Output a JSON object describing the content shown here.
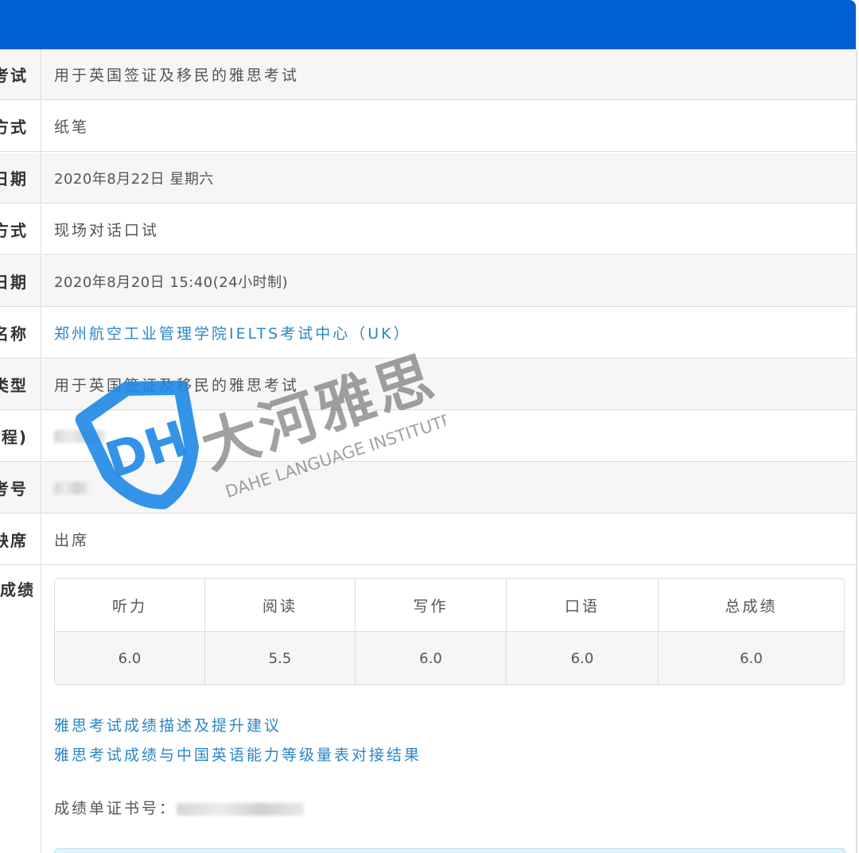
{
  "rows": [
    {
      "label": "考试",
      "value": "用于英国签证及移民的雅思考试"
    },
    {
      "label": "方式",
      "value": "纸笔"
    },
    {
      "label": "日期",
      "value": "2020年8月22日 星期六"
    },
    {
      "label": "方式",
      "value": "现场对话口试"
    },
    {
      "label": "日期",
      "value": "2020年8月20日 15:40(24小时制)"
    },
    {
      "label": "名称",
      "value": "郑州航空工业管理学院IELTS考试中心（UK）"
    },
    {
      "label": "类型",
      "value": "用于英国签证及移民的雅思考试"
    },
    {
      "label": "(课程)",
      "value": "1012…"
    },
    {
      "label": "考号",
      "value": "0…"
    },
    {
      "label": "缺席",
      "value": "出席"
    }
  ],
  "scores": {
    "label": "成绩",
    "headers": [
      "听力",
      "阅读",
      "写作",
      "口语",
      "总成绩"
    ],
    "values": [
      "6.0",
      "5.5",
      "6.0",
      "6.0",
      "6.0"
    ]
  },
  "links": {
    "description": "雅思考试成绩描述及提升建议",
    "cse_mapping": "雅思考试成绩与中国英语能力等级量表对接结果"
  },
  "certificate": {
    "label": "成绩单证书号："
  },
  "watermark": {
    "brand_cn": "大河雅思",
    "brand_en": "DAHE LANGUAGE INSTITUTE",
    "logo_letters": "DH"
  },
  "colors": {
    "topbar": "#005fd1",
    "link": "#2a86c6",
    "watermark": "#1e88e5"
  }
}
